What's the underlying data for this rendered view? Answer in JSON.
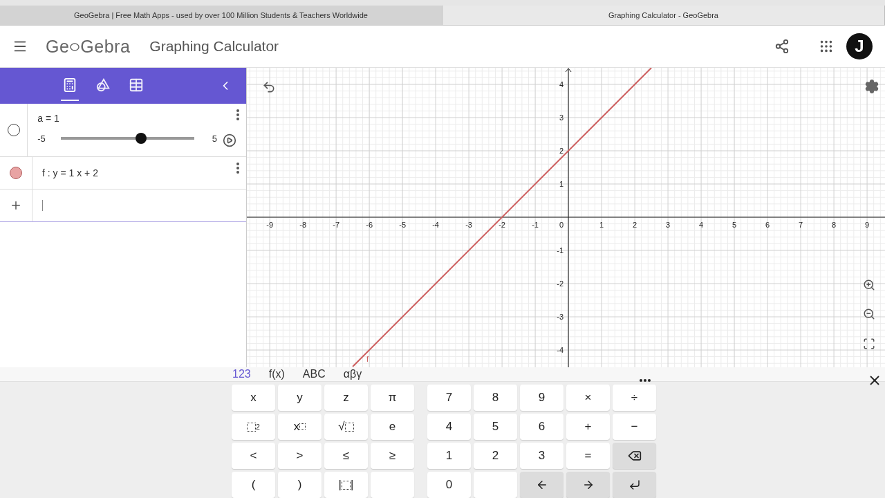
{
  "browser_tabs": [
    {
      "title": "GeoGebra | Free Math Apps - used by over 100 Million Students & Teachers Worldwide",
      "selected": false
    },
    {
      "title": "Graphing Calculator - GeoGebra",
      "selected": true
    }
  ],
  "header": {
    "logo_parts": [
      "Ge",
      "Gebra"
    ],
    "title": "Graphing Calculator",
    "avatar": "J"
  },
  "algebra": {
    "tabs": [
      {
        "kind": "algebra",
        "selected": true
      },
      {
        "kind": "tools",
        "selected": false
      },
      {
        "kind": "table",
        "selected": false
      }
    ],
    "items": [
      {
        "kind": "slider",
        "visible": false,
        "text": "a = 1",
        "min": "-5",
        "max": "5",
        "level": 0.6
      },
      {
        "kind": "function",
        "visible": true,
        "color": "#e8a3a3",
        "text": "f : y = 1 x + 2"
      },
      {
        "kind": "input"
      }
    ]
  },
  "graph": {
    "origin_label": "0",
    "chart_data": {
      "type": "line",
      "grid": true,
      "x": [
        -6.5,
        2.5
      ],
      "series": [
        {
          "name": "f",
          "color": "#cc5c5c",
          "values": [
            -4.5,
            4.5
          ]
        }
      ],
      "xlim": [
        -9.69,
        9.54
      ],
      "ylim": [
        -4.52,
        4.5
      ],
      "xticks": [
        -9,
        -8,
        -7,
        -6,
        -5,
        -4,
        -3,
        -2,
        -1,
        1,
        2,
        3,
        4,
        5,
        6,
        7,
        8,
        9
      ],
      "yticks": [
        -4,
        -3,
        -2,
        -1,
        1,
        2,
        3,
        4
      ]
    }
  },
  "keyboard": {
    "tabs": [
      {
        "label": "123",
        "selected": true
      },
      {
        "label": "f(x)",
        "selected": false
      },
      {
        "label": "ABC",
        "selected": false
      },
      {
        "label": "αβγ",
        "selected": false
      }
    ],
    "rows": [
      {
        "left": [
          {
            "kind": "text",
            "label": "x"
          },
          {
            "kind": "text",
            "label": "y"
          },
          {
            "kind": "text",
            "label": "z"
          },
          {
            "kind": "text",
            "label": "π"
          }
        ],
        "right": [
          {
            "kind": "text",
            "label": "7"
          },
          {
            "kind": "text",
            "label": "8"
          },
          {
            "kind": "text",
            "label": "9"
          },
          {
            "kind": "text",
            "label": "×"
          },
          {
            "kind": "text",
            "label": "÷"
          }
        ]
      },
      {
        "left": [
          {
            "kind": "square",
            "label": "2"
          },
          {
            "kind": "power",
            "label": "x"
          },
          {
            "kind": "sqrt",
            "label": "√"
          },
          {
            "kind": "text",
            "label": "e"
          }
        ],
        "right": [
          {
            "kind": "text",
            "label": "4"
          },
          {
            "kind": "text",
            "label": "5"
          },
          {
            "kind": "text",
            "label": "6"
          },
          {
            "kind": "text",
            "label": "+"
          },
          {
            "kind": "text",
            "label": "−"
          }
        ]
      },
      {
        "left": [
          {
            "kind": "text",
            "label": "<"
          },
          {
            "kind": "text",
            "label": ">"
          },
          {
            "kind": "text",
            "label": "≤"
          },
          {
            "kind": "text",
            "label": "≥"
          }
        ],
        "right": [
          {
            "kind": "text",
            "label": "1"
          },
          {
            "kind": "text",
            "label": "2"
          },
          {
            "kind": "text",
            "label": "3"
          },
          {
            "kind": "text",
            "label": "="
          },
          {
            "kind": "backspace"
          }
        ]
      },
      {
        "left": [
          {
            "kind": "text",
            "label": "("
          },
          {
            "kind": "text",
            "label": ")"
          },
          {
            "kind": "abs",
            "bars": [
              "|",
              "|"
            ]
          },
          {
            "kind": "blank"
          }
        ],
        "right": [
          {
            "kind": "text",
            "label": "0"
          },
          {
            "kind": "blank"
          },
          {
            "kind": "left"
          },
          {
            "kind": "right"
          },
          {
            "kind": "enter"
          }
        ]
      }
    ]
  }
}
